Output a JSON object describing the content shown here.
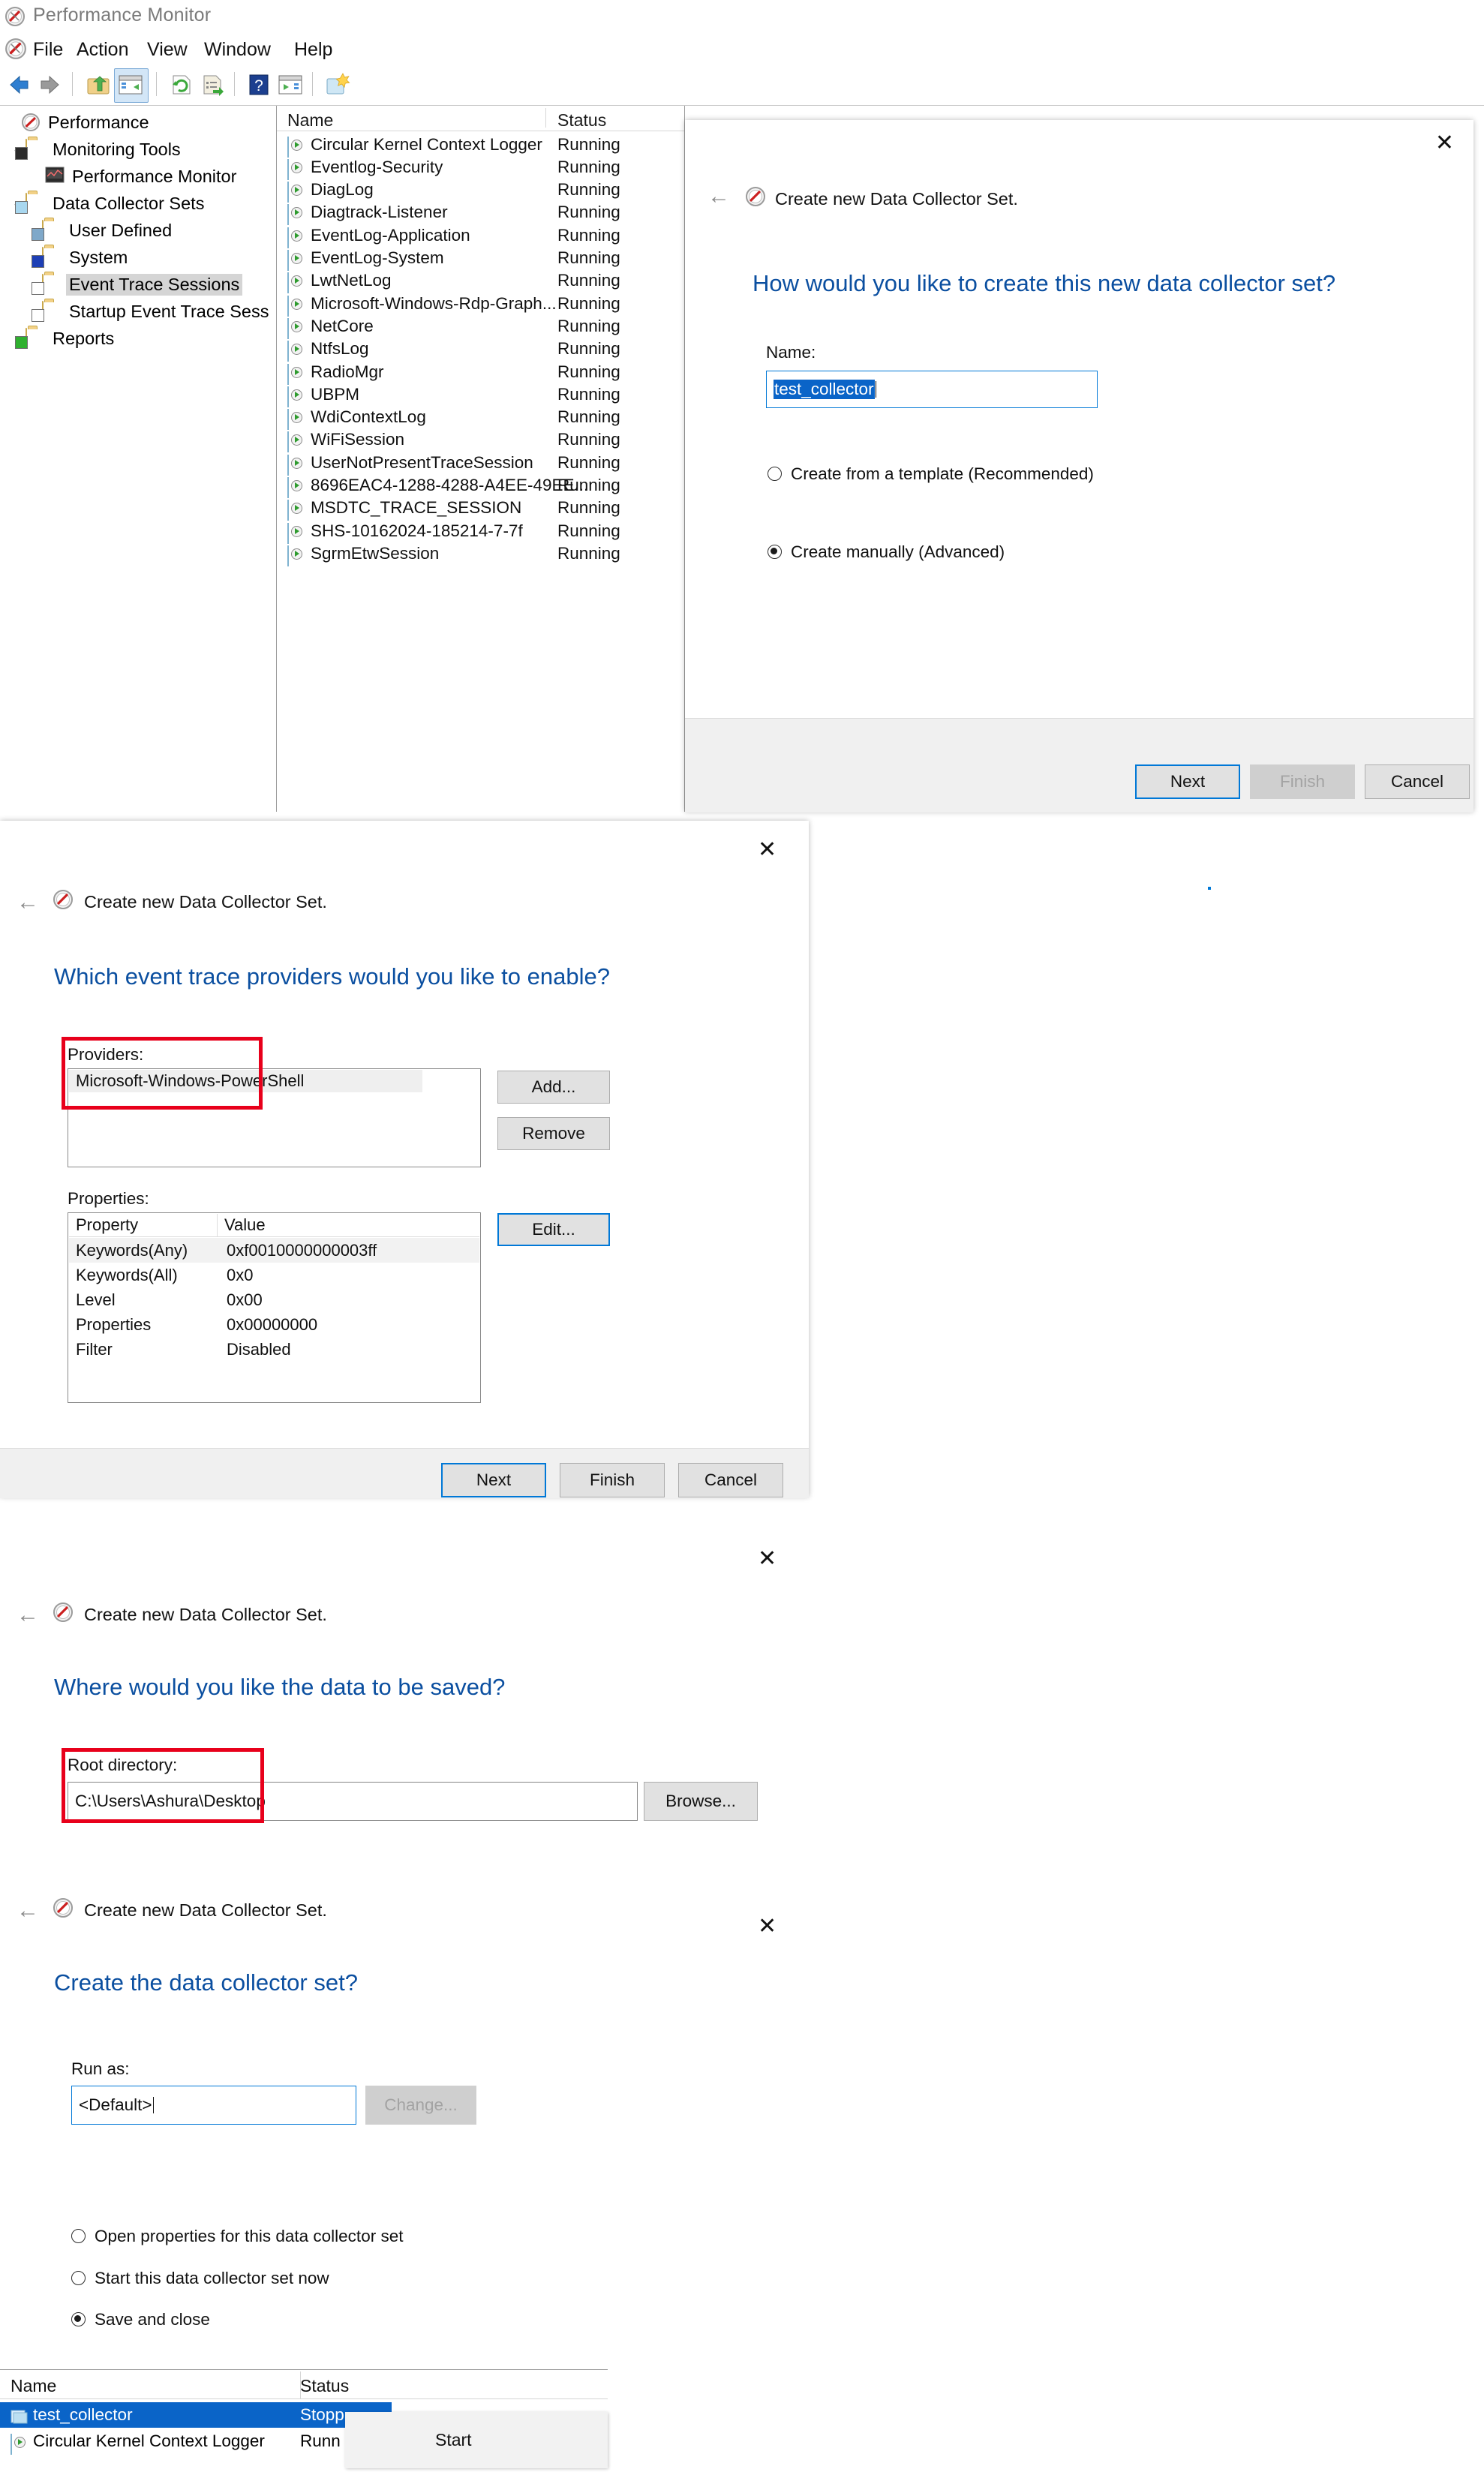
{
  "window": {
    "title": "Performance Monitor",
    "app_icon": "perfmon-icon"
  },
  "menubar": {
    "items": [
      "File",
      "Action",
      "View",
      "Window",
      "Help"
    ]
  },
  "toolbar": {
    "buttons": [
      {
        "name": "back-icon",
        "glyph": "←"
      },
      {
        "name": "forward-icon",
        "glyph": "→"
      },
      {
        "name": "up-folder-icon",
        "glyph": "↰"
      },
      {
        "name": "show-hide-console-tree-icon",
        "glyph": "▤"
      },
      {
        "name": "refresh-icon",
        "glyph": "↻"
      },
      {
        "name": "export-list-icon",
        "glyph": "≡"
      },
      {
        "name": "help-icon",
        "glyph": "?"
      },
      {
        "name": "properties-icon",
        "glyph": "▶"
      },
      {
        "name": "new-window-icon",
        "glyph": "✹"
      }
    ]
  },
  "tree": {
    "root": "Performance",
    "items": [
      {
        "label": "Performance",
        "indent": 0,
        "chevron": "",
        "icon": "perfmon-icon",
        "selected": false
      },
      {
        "label": "Monitoring Tools",
        "indent": 1,
        "chevron": "⌄",
        "icon": "folder-monitor-icon",
        "selected": false
      },
      {
        "label": "Performance Monitor",
        "indent": 2,
        "chevron": "",
        "icon": "perfmon-graph-icon",
        "selected": false
      },
      {
        "label": "Data Collector Sets",
        "indent": 1,
        "chevron": "⌄",
        "icon": "folder-dcs-icon",
        "selected": false
      },
      {
        "label": "User Defined",
        "indent": 2,
        "chevron": "›",
        "icon": "folder-user-icon",
        "selected": false
      },
      {
        "label": "System",
        "indent": 2,
        "chevron": "›",
        "icon": "folder-system-icon",
        "selected": false
      },
      {
        "label": "Event Trace Sessions",
        "indent": 2,
        "chevron": "",
        "icon": "folder-etw-icon",
        "selected": true
      },
      {
        "label": "Startup Event Trace Sess",
        "indent": 2,
        "chevron": "",
        "icon": "folder-etw-icon",
        "selected": false
      },
      {
        "label": "Reports",
        "indent": 1,
        "chevron": "›",
        "icon": "folder-reports-icon",
        "selected": false
      }
    ]
  },
  "session_list": {
    "columns": [
      "Name",
      "Status"
    ],
    "rows": [
      {
        "name": "Circular Kernel Context Logger",
        "status": "Running"
      },
      {
        "name": "Eventlog-Security",
        "status": "Running"
      },
      {
        "name": "DiagLog",
        "status": "Running"
      },
      {
        "name": "Diagtrack-Listener",
        "status": "Running"
      },
      {
        "name": "EventLog-Application",
        "status": "Running"
      },
      {
        "name": "EventLog-System",
        "status": "Running"
      },
      {
        "name": "LwtNetLog",
        "status": "Running"
      },
      {
        "name": "Microsoft-Windows-Rdp-Graph...",
        "status": "Running"
      },
      {
        "name": "NetCore",
        "status": "Running"
      },
      {
        "name": "NtfsLog",
        "status": "Running"
      },
      {
        "name": "RadioMgr",
        "status": "Running"
      },
      {
        "name": "UBPM",
        "status": "Running"
      },
      {
        "name": "WdiContextLog",
        "status": "Running"
      },
      {
        "name": "WiFiSession",
        "status": "Running"
      },
      {
        "name": "UserNotPresentTraceSession",
        "status": "Running"
      },
      {
        "name": "8696EAC4-1288-4288-A4EE-49EE...",
        "status": "Running"
      },
      {
        "name": "MSDTC_TRACE_SESSION",
        "status": "Running"
      },
      {
        "name": "SHS-10162024-185214-7-7f",
        "status": "Running"
      },
      {
        "name": "SgrmEtwSession",
        "status": "Running"
      }
    ]
  },
  "wizard1": {
    "title": "Create new Data Collector Set.",
    "heading": "How would you like to create this new data collector set?",
    "name_label": "Name:",
    "name_value": "test_collector",
    "options": [
      {
        "label": "Create from a template (Recommended)",
        "selected": false
      },
      {
        "label": "Create manually (Advanced)",
        "selected": true
      }
    ],
    "buttons": {
      "next": "Next",
      "finish": "Finish",
      "cancel": "Cancel"
    }
  },
  "wizard2": {
    "title": "Create new Data Collector Set.",
    "heading": "Which event trace providers would you like to enable?",
    "providers_label": "Providers:",
    "providers": [
      "Microsoft-Windows-PowerShell"
    ],
    "add_label": "Add...",
    "remove_label": "Remove",
    "properties_label": "Properties:",
    "edit_label": "Edit...",
    "property_columns": [
      "Property",
      "Value"
    ],
    "property_rows": [
      {
        "property": "Keywords(Any)",
        "value": "0xf0010000000003ff"
      },
      {
        "property": "Keywords(All)",
        "value": "0x0"
      },
      {
        "property": "Level",
        "value": "0x00"
      },
      {
        "property": "Properties",
        "value": "0x00000000"
      },
      {
        "property": "Filter",
        "value": "Disabled"
      }
    ],
    "buttons": {
      "next": "Next",
      "finish": "Finish",
      "cancel": "Cancel"
    }
  },
  "wizard3": {
    "title": "Create new Data Collector Set.",
    "heading": "Where would you like the data to be saved?",
    "root_label": "Root directory:",
    "root_value": "C:\\Users\\Ashura\\Desktop",
    "browse_label": "Browse..."
  },
  "wizard4": {
    "title": "Create new Data Collector Set.",
    "heading": "Create the data collector set?",
    "runas_label": "Run as:",
    "runas_value": "<Default>",
    "change_label": "Change...",
    "options": [
      {
        "label": "Open properties for this data collector set",
        "selected": false
      },
      {
        "label": "Start this data collector set now",
        "selected": false
      },
      {
        "label": "Save and close",
        "selected": true
      }
    ]
  },
  "bottom_list": {
    "columns": [
      "Name",
      "Status"
    ],
    "rows": [
      {
        "name": "test_collector",
        "status": "Stopp",
        "selected": true
      },
      {
        "name": "Circular Kernel Context Logger",
        "status": "Runn",
        "selected": false
      }
    ],
    "context_menu": [
      "Start"
    ]
  },
  "colors": {
    "accent": "#0078d7",
    "heading": "#0b4fa0",
    "selection": "#0a64c8",
    "highlight_box": "#e8001b"
  }
}
